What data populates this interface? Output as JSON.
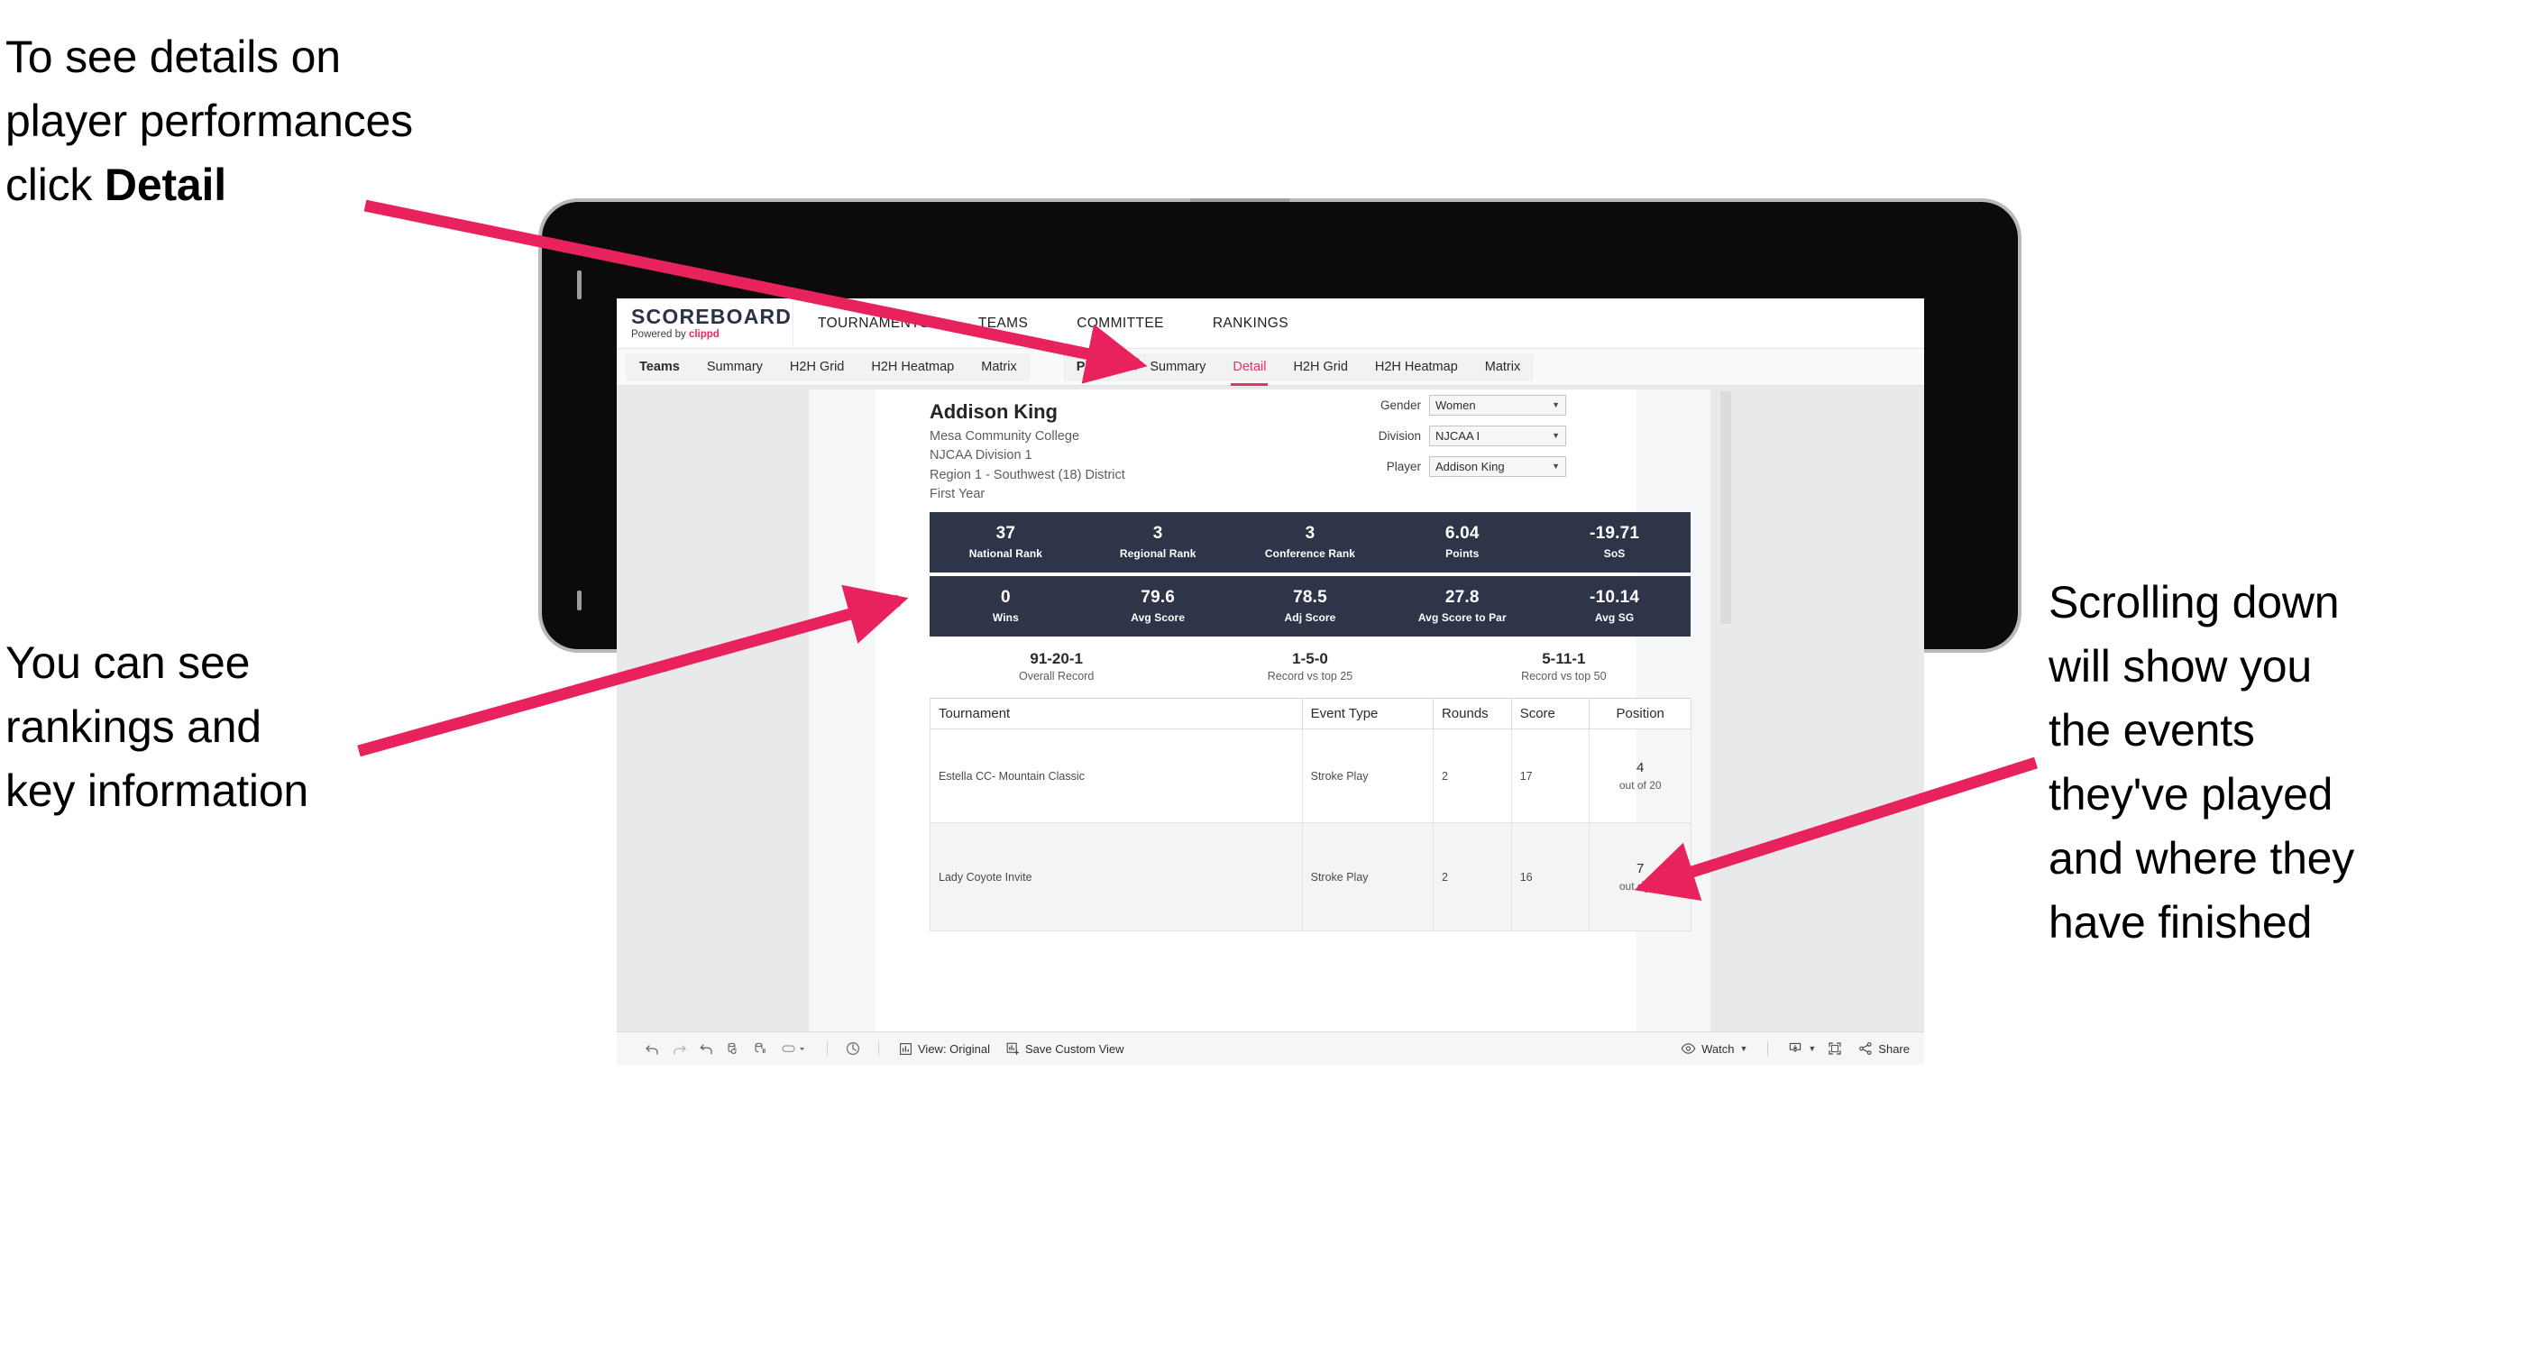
{
  "annotations": [
    {
      "id": "detail",
      "text_before": "To see details on\nplayer performances\nclick ",
      "bold": "Detail",
      "text_after": ""
    },
    {
      "id": "rankings",
      "text": "You can see\nrankings and\nkey information"
    },
    {
      "id": "scroll",
      "text": "Scrolling down\nwill show you\nthe events\nthey've played\nand where they\nhave finished"
    }
  ],
  "accent_color": "#ec2a5b",
  "arrow_color": "#e8225c",
  "app": {
    "brand": {
      "title": "SCOREBOARD",
      "powered_prefix": "Powered by ",
      "powered_name": "clippd"
    },
    "topnav": [
      {
        "label": "TOURNAMENTS"
      },
      {
        "label": "TEAMS"
      },
      {
        "label": "COMMITTEE"
      },
      {
        "label": "RANKINGS"
      }
    ],
    "subnav": {
      "group1": [
        {
          "label": "Teams",
          "active": false
        },
        {
          "label": "Summary",
          "active": false
        },
        {
          "label": "H2H Grid",
          "active": false
        },
        {
          "label": "H2H Heatmap",
          "active": false
        },
        {
          "label": "Matrix",
          "active": false
        }
      ],
      "group2": [
        {
          "label": "Players",
          "active": false
        },
        {
          "label": "Summary",
          "active": false
        },
        {
          "label": "Detail",
          "active": true
        },
        {
          "label": "H2H Grid",
          "active": false
        },
        {
          "label": "H2H Heatmap",
          "active": false
        },
        {
          "label": "Matrix",
          "active": false
        }
      ]
    },
    "player": {
      "name": "Addison King",
      "school": "Mesa Community College",
      "division": "NJCAA Division 1",
      "region": "Region 1 - Southwest (18) District",
      "year": "First Year"
    },
    "filters": [
      {
        "label": "Gender",
        "value": "Women"
      },
      {
        "label": "Division",
        "value": "NJCAA I"
      },
      {
        "label": "Player",
        "value": "Addison King"
      }
    ],
    "stats_row1": [
      {
        "value": "37",
        "label": "National Rank"
      },
      {
        "value": "3",
        "label": "Regional Rank"
      },
      {
        "value": "3",
        "label": "Conference Rank"
      },
      {
        "value": "6.04",
        "label": "Points"
      },
      {
        "value": "-19.71",
        "label": "SoS"
      }
    ],
    "stats_row2": [
      {
        "value": "0",
        "label": "Wins"
      },
      {
        "value": "79.6",
        "label": "Avg Score"
      },
      {
        "value": "78.5",
        "label": "Adj Score"
      },
      {
        "value": "27.8",
        "label": "Avg Score to Par"
      },
      {
        "value": "-10.14",
        "label": "Avg SG"
      }
    ],
    "records": [
      {
        "value": "91-20-1",
        "label": "Overall Record"
      },
      {
        "value": "1-5-0",
        "label": "Record vs top 25"
      },
      {
        "value": "5-11-1",
        "label": "Record vs top 50"
      }
    ],
    "table": {
      "headers": [
        "Tournament",
        "Event Type",
        "Rounds",
        "Score",
        "Position"
      ],
      "rows": [
        {
          "tournament": "Estella CC- Mountain Classic",
          "event_type": "Stroke Play",
          "rounds": "2",
          "score": "17",
          "position_num": "4",
          "position_of": "out of 20"
        },
        {
          "tournament": "Lady Coyote Invite",
          "event_type": "Stroke Play",
          "rounds": "2",
          "score": "16",
          "position_num": "7",
          "position_of": "out of 20"
        }
      ]
    },
    "toolbar": {
      "icons": [
        "undo-icon",
        "redo-icon",
        "revert-icon",
        "refresh-data-icon",
        "pause-updates-icon",
        "device-layout-icon"
      ],
      "view_label": "View: Original",
      "save_label": "Save Custom View",
      "watch_label": "Watch",
      "share_label": "Share"
    }
  }
}
